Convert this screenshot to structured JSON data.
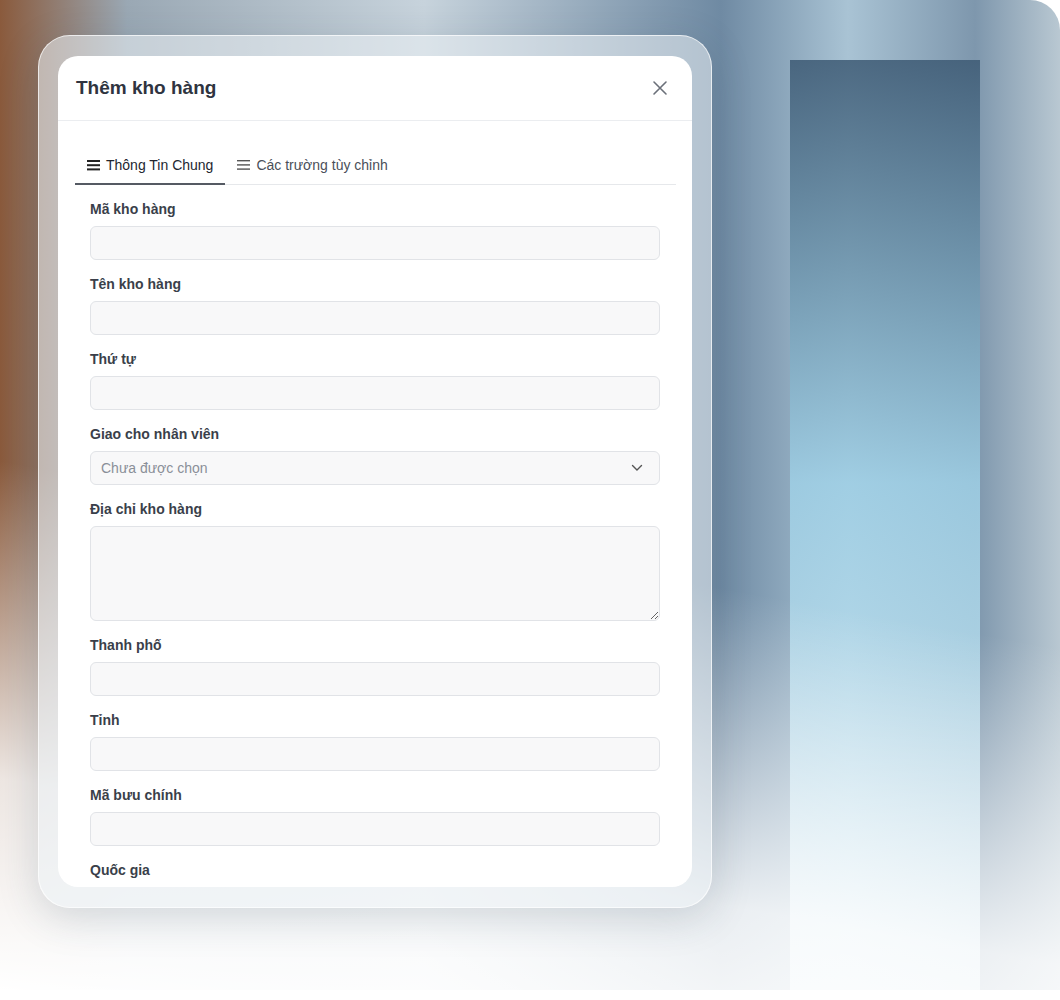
{
  "dialog": {
    "title": "Thêm kho hàng"
  },
  "tabs": [
    {
      "label": "Thông Tin Chung",
      "selected": true
    },
    {
      "label": "Các trường tùy chỉnh",
      "selected": false
    }
  ],
  "fields": [
    {
      "label": "Mã kho hàng",
      "kind": "input"
    },
    {
      "label": "Tên kho hàng",
      "kind": "input"
    },
    {
      "label": "Thứ tự",
      "kind": "input"
    },
    {
      "label": "Giao cho nhân viên",
      "kind": "select",
      "placeholder": "Chưa được chọn"
    },
    {
      "label": "Địa chỉ kho hàng",
      "kind": "textarea"
    },
    {
      "label": "Thanh phố",
      "kind": "input"
    },
    {
      "label": "Tỉnh",
      "kind": "input"
    },
    {
      "label": "Mã bưu chính",
      "kind": "input"
    },
    {
      "label": "Quốc gia",
      "kind": "input"
    }
  ]
}
